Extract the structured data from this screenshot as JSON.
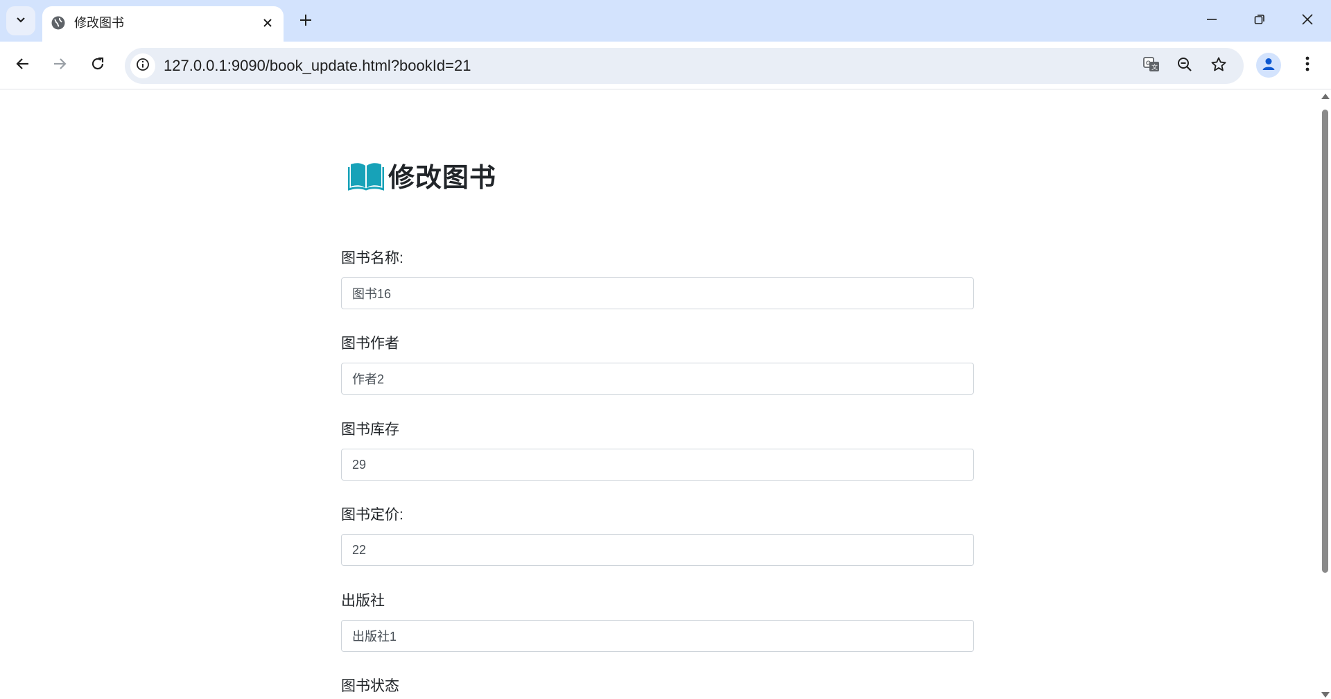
{
  "browser": {
    "tab_title": "修改图书",
    "url": "127.0.0.1:9090/book_update.html?bookId=21"
  },
  "page": {
    "heading": "修改图书",
    "fields": [
      {
        "label": "图书名称:",
        "value": "图书16"
      },
      {
        "label": "图书作者",
        "value": "作者2"
      },
      {
        "label": "图书库存",
        "value": "29"
      },
      {
        "label": "图书定价:",
        "value": "22"
      },
      {
        "label": "出版社",
        "value": "出版社1"
      },
      {
        "label": "图书状态"
      }
    ]
  },
  "colors": {
    "tabstrip": "#d3e3fd",
    "omnibox": "#e9eef6",
    "book_icon": "#17a2b8",
    "input_border": "#ced4da"
  }
}
